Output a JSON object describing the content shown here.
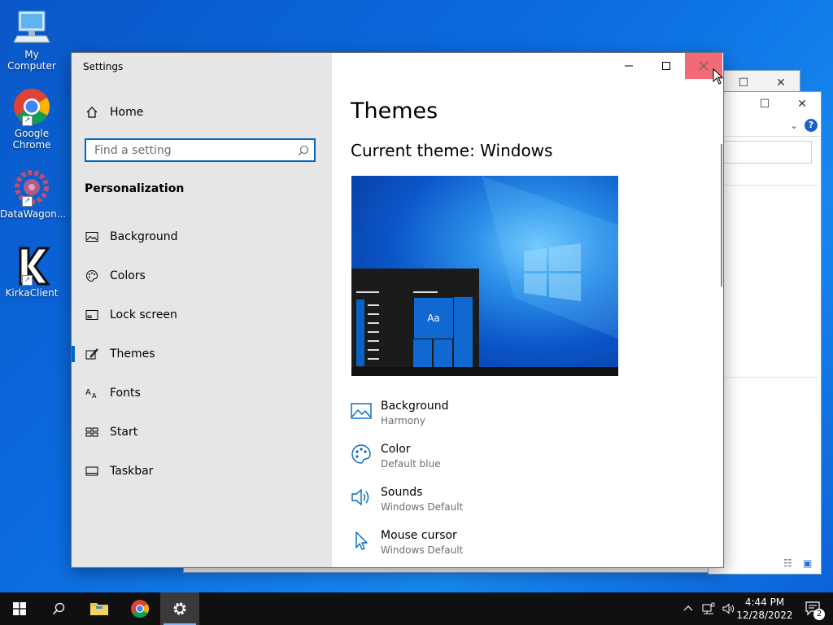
{
  "desktop": {
    "icons": [
      {
        "label": "My Computer",
        "icon": "computer-icon"
      },
      {
        "label": "Google Chrome",
        "icon": "chrome-icon"
      },
      {
        "label": "DataWagon...",
        "icon": "datawagon-icon"
      },
      {
        "label": "KirkaClient",
        "icon": "kirka-icon"
      }
    ]
  },
  "settings": {
    "window_title": "Settings",
    "nav_home": "Home",
    "search_placeholder": "Find a setting",
    "section_title": "Personalization",
    "nav_items": [
      {
        "label": "Background",
        "icon": "image-icon"
      },
      {
        "label": "Colors",
        "icon": "palette-icon"
      },
      {
        "label": "Lock screen",
        "icon": "lock-screen-icon"
      },
      {
        "label": "Themes",
        "icon": "themes-icon",
        "selected": true
      },
      {
        "label": "Fonts",
        "icon": "fonts-icon"
      },
      {
        "label": "Start",
        "icon": "start-icon"
      },
      {
        "label": "Taskbar",
        "icon": "taskbar-icon"
      }
    ],
    "content": {
      "title": "Themes",
      "current_theme": "Current theme: Windows",
      "preview_sample": "Aa",
      "items": [
        {
          "label": "Background",
          "value": "Harmony",
          "icon": "image-icon"
        },
        {
          "label": "Color",
          "value": "Default blue",
          "icon": "palette-icon"
        },
        {
          "label": "Sounds",
          "value": "Windows Default",
          "icon": "speaker-icon"
        },
        {
          "label": "Mouse cursor",
          "value": "Windows Default",
          "icon": "cursor-icon"
        }
      ]
    }
  },
  "taskbar": {
    "time": "4:44 PM",
    "date": "12/28/2022",
    "notification_count": "2"
  },
  "colors": {
    "accent": "#0067c0",
    "close_hover": "#e81123",
    "taskbar": "#101010"
  }
}
